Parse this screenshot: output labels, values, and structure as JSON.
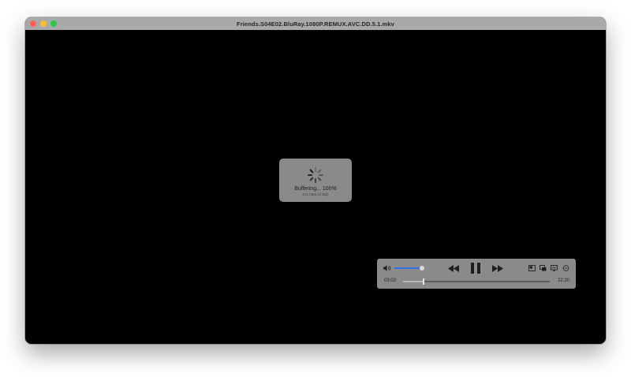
{
  "window": {
    "title": "Friends.S04E02.BluRay.1080P.REMUX.AVC.DD.5.1.mkv"
  },
  "buffering": {
    "status": "Buffering... 100%",
    "detail": "3 G (463.12 Kib)"
  },
  "controls": {
    "volume_level": 0.92,
    "elapsed": "03:03",
    "remaining": "22:20",
    "progress": 0.14,
    "accent_color": "#2f6fe6",
    "icons": [
      "speaker-icon",
      "rewind-icon",
      "pause-icon",
      "fast-forward-icon",
      "picture-in-picture-icon",
      "subtitles-icon",
      "airplay-icon",
      "more-icon"
    ]
  }
}
